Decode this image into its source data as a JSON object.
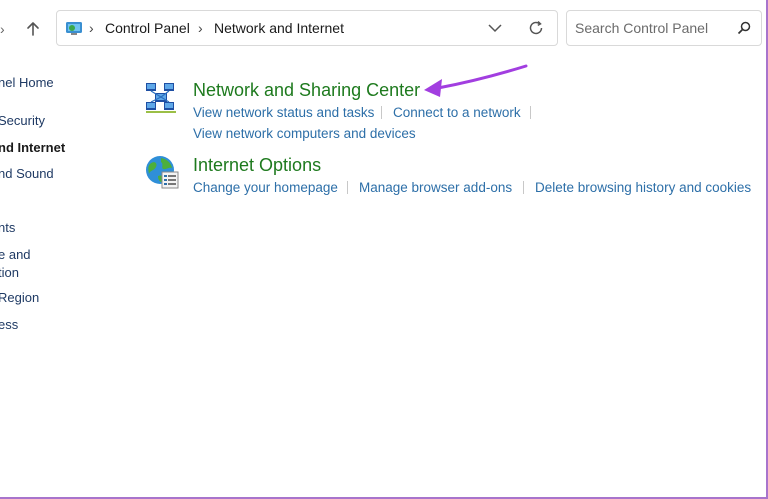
{
  "address_bar": {
    "breadcrumbs": [
      "Control Panel",
      "Network and Internet"
    ]
  },
  "search": {
    "placeholder": "Search Control Panel"
  },
  "sidebar": {
    "items": [
      {
        "label": "nel Home",
        "current": false
      },
      {
        "label": "Security",
        "current": false
      },
      {
        "label": "nd Internet",
        "current": true
      },
      {
        "label": "nd Sound",
        "current": false
      },
      {
        "label": "nts",
        "current": false
      },
      {
        "label": "e and",
        "current": false
      },
      {
        "label": "tion",
        "current": false
      },
      {
        "label": "Region",
        "current": false
      },
      {
        "label": "ess",
        "current": false
      }
    ]
  },
  "categories": [
    {
      "title": "Network and Sharing Center",
      "icon": "network-sharing-icon",
      "tasks": [
        "View network status and tasks",
        "Connect to a network",
        "View network computers and devices"
      ]
    },
    {
      "title": "Internet Options",
      "icon": "internet-options-icon",
      "tasks": [
        "Change your homepage",
        "Manage browser add-ons",
        "Delete browsing history and cookies"
      ]
    }
  ],
  "annotation": {
    "arrow_color": "#a23ee0"
  }
}
